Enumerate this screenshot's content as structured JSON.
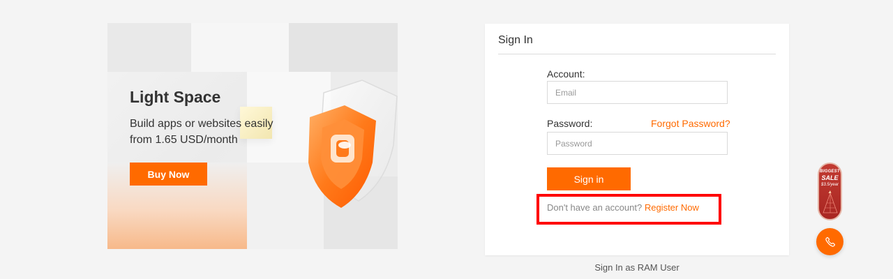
{
  "banner": {
    "title": "Light Space",
    "subtitle": "Build apps or websites easily from 1.65 USD/month",
    "button_label": "Buy Now"
  },
  "signin": {
    "title": "Sign In",
    "account_label": "Account:",
    "account_placeholder": "Email",
    "account_value": "",
    "password_label": "Password:",
    "password_placeholder": "Password",
    "password_value": "",
    "forgot_label": "Forgot Password?",
    "submit_label": "Sign in",
    "register_prompt": "Don't have an account?",
    "register_label": "Register Now"
  },
  "ram_link_label": "Sign In as RAM User",
  "sale_badge": {
    "line1": "BIGGEST",
    "line2": "SALE",
    "line3": "$3.5/year"
  },
  "icons": {
    "phone": "phone-icon",
    "shield": "shield-icon"
  },
  "colors": {
    "accent": "#ff6a00",
    "highlight": "#ff0000",
    "background": "#f4f4f4"
  }
}
